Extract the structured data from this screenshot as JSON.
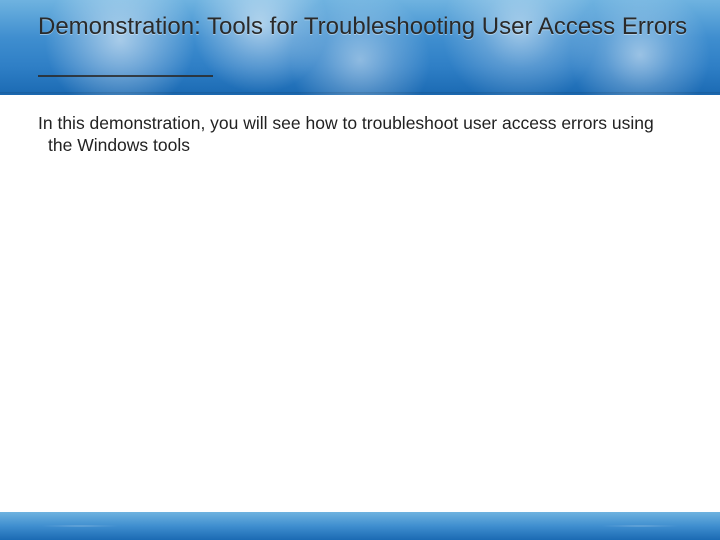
{
  "slide": {
    "title": "Demonstration: Tools for Troubleshooting User Access Errors",
    "body": "In this demonstration, you will see how to troubleshoot user access errors using the Windows tools"
  }
}
